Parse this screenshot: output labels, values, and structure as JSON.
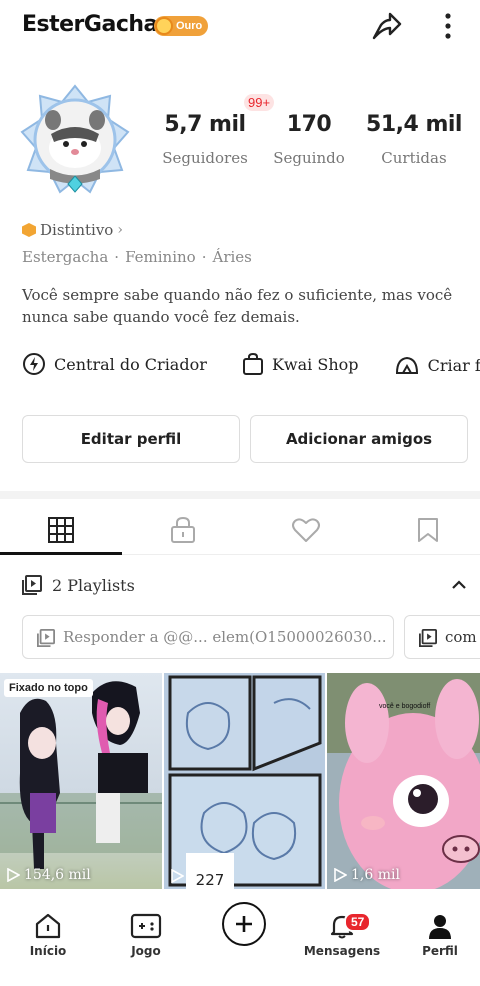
{
  "profile": {
    "username": "EsterGacha",
    "badge_label": "Ouro",
    "notif_pill": "99+",
    "stats": [
      {
        "value": "5,7 mil",
        "label": "Seguidores"
      },
      {
        "value": "170",
        "label": "Seguindo"
      },
      {
        "value": "51,4 mil",
        "label": "Curtidas"
      }
    ],
    "distintivo": "Distintivo",
    "meta": [
      "Estergacha",
      "Feminino",
      "Áries"
    ],
    "bio": "Você sempre sabe quando não fez o suficiente, mas você nunca sabe quando você fez demais."
  },
  "shortcuts": [
    "Central do Criador",
    "Kwai Shop",
    "Criar fan"
  ],
  "actions": {
    "edit": "Editar perfil",
    "add_friends": "Adicionar amigos"
  },
  "playlists": {
    "title": "2 Playlists",
    "chips": [
      "Responder a @@... elem(O15000026030...",
      "com"
    ]
  },
  "grid": [
    {
      "pin": "Fixado no topo",
      "views": "154,6 mil"
    },
    {
      "count": "227"
    },
    {
      "views": "1,6 mil",
      "caption": "você e bogodioff"
    }
  ],
  "nav": {
    "items": [
      "Início",
      "Jogo",
      "Mensagens",
      "Perfil"
    ],
    "messages_badge": "57"
  },
  "colors": {
    "accent_red": "#e8262d",
    "badge_gold": "#f0a13a"
  }
}
